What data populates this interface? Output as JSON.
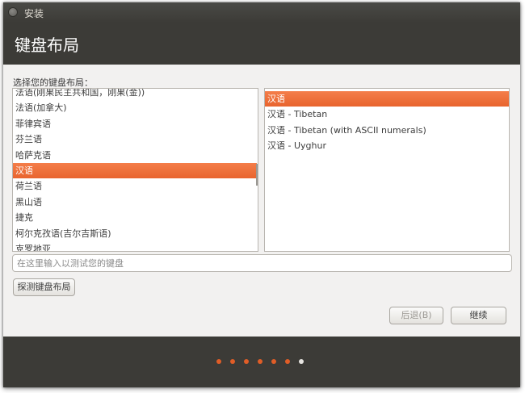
{
  "window": {
    "title": "安装"
  },
  "header": {
    "title": "键盘布局"
  },
  "prompt": "选择您的键盘布局：",
  "layouts": [
    "法语(刚果民主共和国，刚果(金))",
    "法语(加拿大)",
    "菲律宾语",
    "芬兰语",
    "哈萨克语",
    "汉语",
    "荷兰语",
    "黑山语",
    "捷克",
    "柯尔克孜语(吉尔吉斯语)",
    "克罗地亚"
  ],
  "selected_layout_index": 5,
  "variants": [
    "汉语",
    "汉语 - Tibetan",
    "汉语 - Tibetan (with ASCII numerals)",
    "汉语 - Uyghur"
  ],
  "selected_variant_index": 0,
  "test_input": {
    "placeholder": "在这里输入以测试您的键盘",
    "value": ""
  },
  "buttons": {
    "detect": "探测键盘布局",
    "back": "后退(B)",
    "next": "继续"
  },
  "progress": {
    "total_steps": 7,
    "current_step": 7
  },
  "colors": {
    "accent": "#e05d27",
    "chrome": "#3c3b37",
    "background": "#f2f1f0"
  }
}
